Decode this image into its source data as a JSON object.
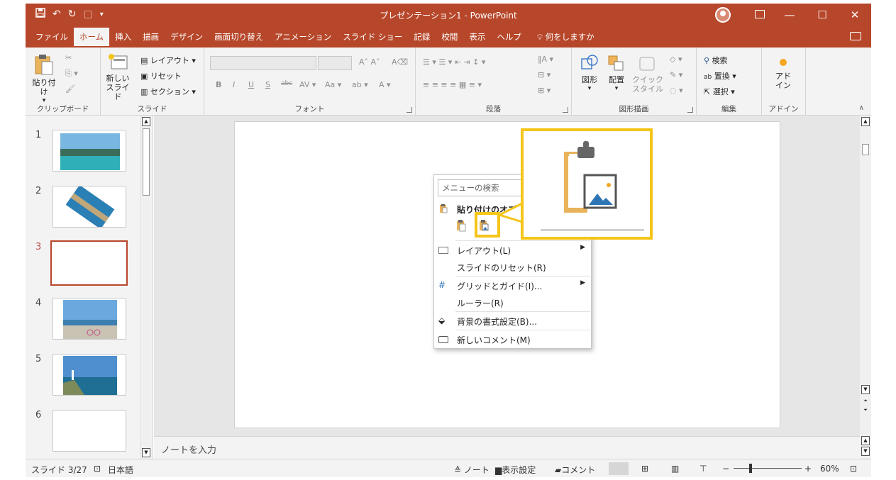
{
  "window": {
    "title": "プレゼンテーション1 - PowerPoint"
  },
  "colors": {
    "accent": "#b7472a",
    "highlight": "#f5c518"
  },
  "tabs": [
    "ファイル",
    "ホーム",
    "挿入",
    "描画",
    "デザイン",
    "画面切り替え",
    "アニメーション",
    "スライド ショー",
    "記録",
    "校閲",
    "表示",
    "ヘルプ"
  ],
  "tell_me": "何をしますか",
  "ribbon": {
    "clipboard": {
      "paste": "貼り付け",
      "label": "クリップボード"
    },
    "slides": {
      "new_slide_1": "新しい",
      "new_slide_2": "スライド",
      "layout": "レイアウト",
      "reset": "リセット",
      "section": "セクション",
      "label": "スライド"
    },
    "font": {
      "label": "フォント",
      "bold": "B",
      "italic": "I",
      "underline": "U",
      "shadow": "S",
      "strike": "abc",
      "case": "Aa"
    },
    "paragraph": {
      "label": "段落"
    },
    "drawing": {
      "shapes": "図形",
      "arrange": "配置",
      "quick_style_1": "クイック",
      "quick_style_2": "スタイル",
      "label": "図形描画"
    },
    "editing": {
      "find": "検索",
      "replace": "置換",
      "select": "選択",
      "label": "編集"
    },
    "addins": {
      "addin_1": "アド",
      "addin_2": "イン",
      "label": "アドイン"
    }
  },
  "thumbnails": [
    {
      "num": "1",
      "kind": "photo-sea"
    },
    {
      "num": "2",
      "kind": "photo-rotated"
    },
    {
      "num": "3",
      "kind": "blank",
      "selected": true
    },
    {
      "num": "4",
      "kind": "photo-beach"
    },
    {
      "num": "5",
      "kind": "photo-lighthouse"
    },
    {
      "num": "6",
      "kind": "blank"
    }
  ],
  "notes_placeholder": "ノートを入力",
  "status": {
    "slide": "スライド 3/27",
    "lang": "日本語",
    "notes": "ノート",
    "display": "表示設定",
    "comments": "コメント",
    "zoom": "60%"
  },
  "context_menu": {
    "search_placeholder": "メニューの検索",
    "paste_options": "貼り付けのオプション:",
    "items": [
      {
        "label": "レイアウト(L)",
        "submenu": true
      },
      {
        "label": "スライドのリセット(R)",
        "submenu": false
      },
      {
        "label": "グリッドとガイド(I)...",
        "submenu": true
      },
      {
        "label": "ルーラー(R)",
        "submenu": false
      },
      {
        "label": "背景の書式設定(B)...",
        "submenu": false
      },
      {
        "label": "新しいコメント(M)",
        "submenu": false
      }
    ]
  }
}
